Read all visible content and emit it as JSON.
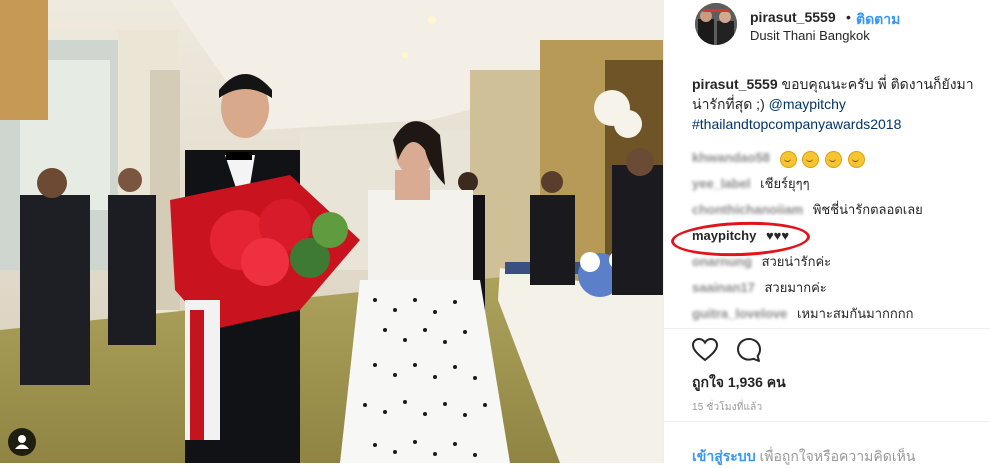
{
  "post": {
    "username": "pirasut_5559",
    "separator": "•",
    "follow_label": "ติดตาม",
    "location": "Dusit Thani Bangkok"
  },
  "caption": {
    "username": "pirasut_5559",
    "text": "ขอบคุณนะครับ พี่ ติดงานก็ยังมาน่ารักที่สุด ;)",
    "mention": "@maypitchy",
    "hashtag": "#thailandtopcompanyawards2018"
  },
  "comments": [
    {
      "user": "khwandao58",
      "text": "",
      "emoji_count": 4
    },
    {
      "user": "yee_label",
      "text": "เชียร์ยุๆๆ"
    },
    {
      "user": "chonthichanoiiam",
      "text": "พิชชี่น่ารักตลอดเลย"
    },
    {
      "user": "maypitchy",
      "text": "♥♥♥"
    },
    {
      "user": "onarnung",
      "text": "สวยน่ารักค่ะ"
    },
    {
      "user": "saainan17",
      "text": "สวยมากค่ะ"
    },
    {
      "user": "guitra_lovelove",
      "text": "เหมาะสมกันมากกกก"
    }
  ],
  "stats": {
    "likes_label": "ถูกใจ 1,936 คน",
    "time_label": "15 ชั่วโมงที่แล้ว"
  },
  "login": {
    "link_label": "เข้าสู่ระบบ",
    "rest_label": "เพื่อถูกใจหรือความคิดเห็น"
  },
  "colors": {
    "link_blue": "#3897f0",
    "mention_blue": "#003569",
    "highlight_red": "#e3121b",
    "text": "#262626"
  },
  "icons": {
    "like": "heart-icon",
    "comment": "comment-icon",
    "user_tag": "user-tag-icon"
  }
}
